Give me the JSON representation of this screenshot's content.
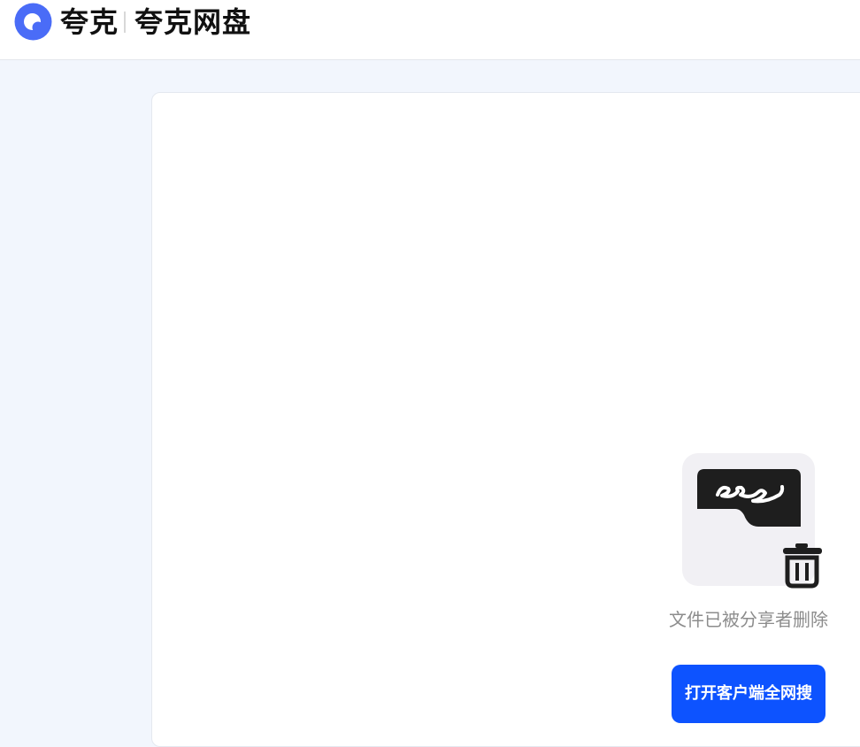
{
  "header": {
    "brand_name": "夸克",
    "product_name": "夸克网盘",
    "logo_icon": "quark-logo-icon",
    "brand_color": "#4a6cf7"
  },
  "main": {
    "illustration_icon": "deleted-file-illustration",
    "trash_icon": "trash-icon",
    "status_message": "文件已被分享者删除",
    "open_client_button": "打开客户端全网搜",
    "button_color": "#0d53ff"
  }
}
